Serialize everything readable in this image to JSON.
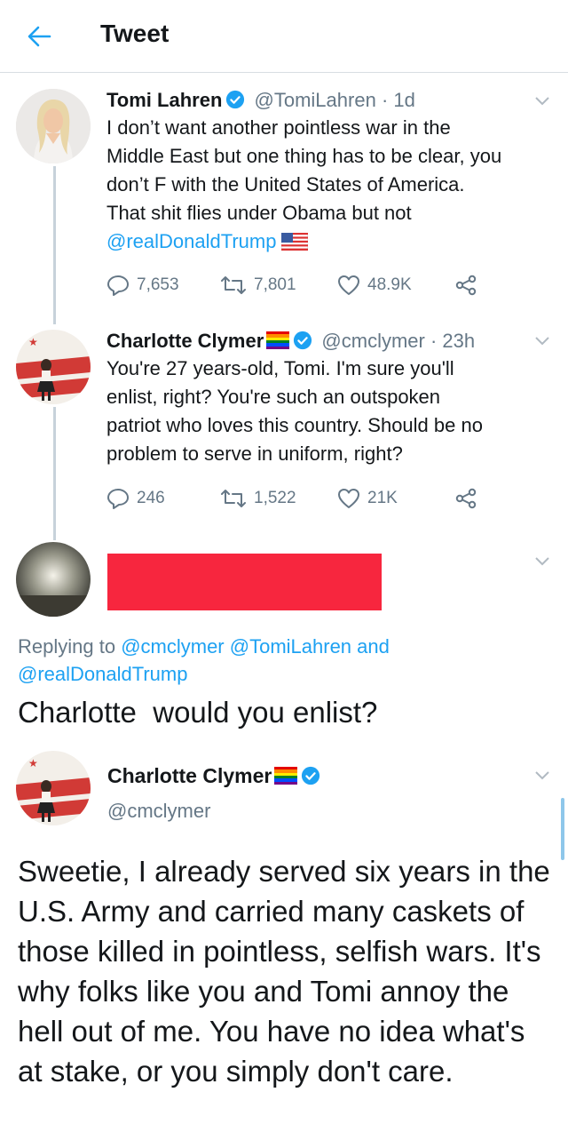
{
  "header": {
    "title": "Tweet"
  },
  "tweets": [
    {
      "name": "Tomi Lahren",
      "handle": "@TomiLahren",
      "time": "· 1d",
      "body_lines": [
        "I don’t want another pointless war in the",
        "Middle East but one thing has to be clear, you",
        "don’t F with the United States of America.",
        "That shit flies under Obama but not"
      ],
      "mention": "@realDonaldTrump",
      "replies": "7,653",
      "retweets": "7,801",
      "likes": "48.9K"
    },
    {
      "name": "Charlotte Clymer",
      "handle": "@cmclymer",
      "time": "· 23h",
      "body_lines": [
        "You're 27 years-old, Tomi. I'm sure you'll",
        "enlist, right? You're such an outspoken",
        "patriot who loves this country. Should be no",
        "problem to serve in uniform, right?"
      ],
      "replies": "246",
      "retweets": "1,522",
      "likes": "21K"
    }
  ],
  "redacted_reply": {
    "replying_prefix": "Replying to",
    "replying_mentions_1": "@cmclymer @TomiLahren",
    "replying_and": "and",
    "replying_mentions_2": "@realDonaldTrump",
    "text": "Charlotte  would you enlist?"
  },
  "main_tweet": {
    "name": "Charlotte Clymer",
    "handle": "@cmclymer",
    "body": "Sweetie, I already served six years in the U.S. Army and carried many caskets of those killed in pointless, selfish wars. It's why folks like you and Tomi annoy the hell out of me. You have no idea what's at stake, or you simply don't care."
  },
  "colors": {
    "accent": "#1da1f2",
    "secondary_text": "#657786",
    "redaction": "#f7263e"
  },
  "icons": [
    "back-arrow-icon",
    "verified-badge-icon",
    "rainbow-flag-icon",
    "us-flag-icon",
    "reply-icon",
    "retweet-icon",
    "like-icon",
    "share-icon",
    "chevron-down-icon"
  ]
}
